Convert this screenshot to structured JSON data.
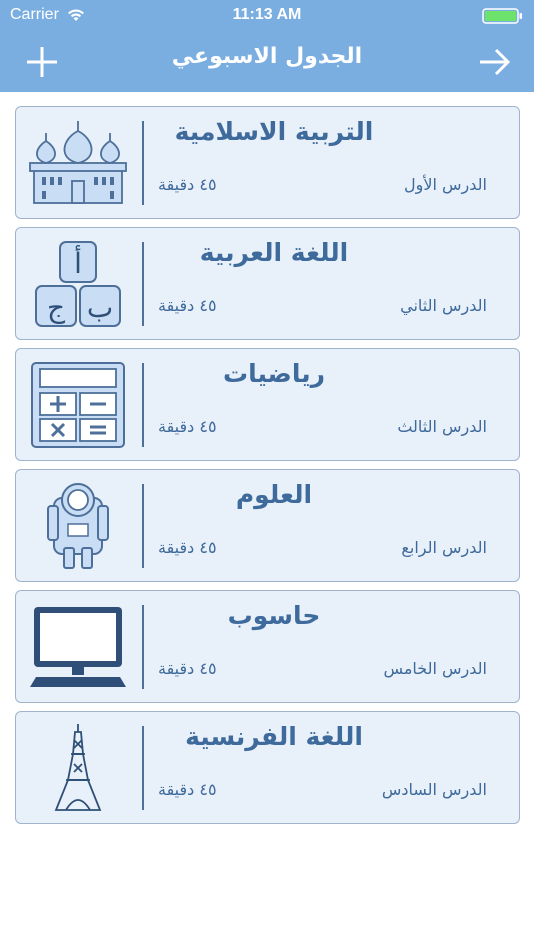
{
  "status_bar": {
    "carrier": "Carrier",
    "time": "11:13 AM"
  },
  "nav": {
    "title": "الجدول الاسبوعي",
    "left_icon": "plus-icon",
    "right_icon": "arrow-right-icon"
  },
  "colors": {
    "header": "#7aaee0",
    "card_bg": "#e8f0f9",
    "card_border": "#9fb4cc",
    "text": "#3f6a9c",
    "battery": "#6ee36b"
  },
  "lessons": [
    {
      "subject": "التربية الاسلامية",
      "lesson": "الدرس الأول",
      "duration": "٤٥ دقيقة",
      "icon": "mosque-icon"
    },
    {
      "subject": "اللغة العربية",
      "lesson": "الدرس الثاني",
      "duration": "٤٥ دقيقة",
      "icon": "arabic-letters-icon",
      "letters": [
        "أ",
        "ب",
        "ج"
      ]
    },
    {
      "subject": "رياضيات",
      "lesson": "الدرس الثالث",
      "duration": "٤٥ دقيقة",
      "icon": "calculator-icon"
    },
    {
      "subject": "العلوم",
      "lesson": "الدرس الرابع",
      "duration": "٤٥ دقيقة",
      "icon": "astronaut-icon"
    },
    {
      "subject": "حاسوب",
      "lesson": "الدرس الخامس",
      "duration": "٤٥ دقيقة",
      "icon": "computer-icon"
    },
    {
      "subject": "اللغة الفرنسية",
      "lesson": "الدرس السادس",
      "duration": "٤٥ دقيقة",
      "icon": "eiffel-tower-icon"
    }
  ]
}
